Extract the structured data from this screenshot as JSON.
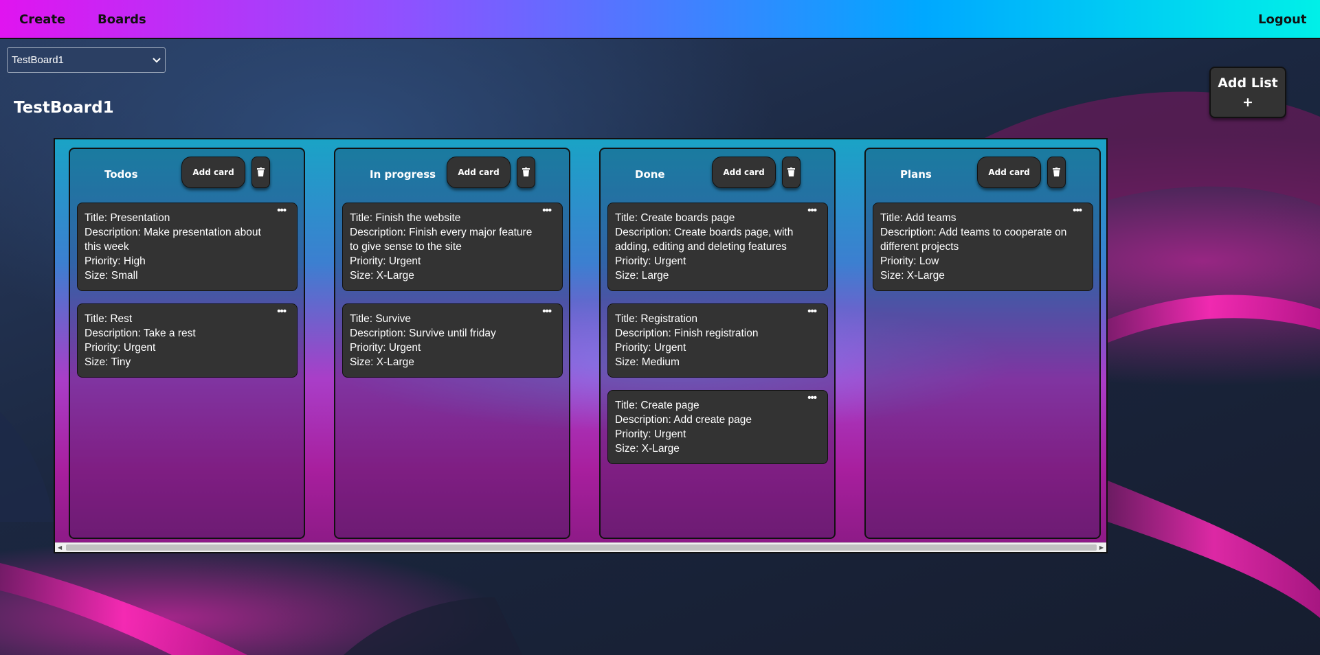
{
  "nav": {
    "create": "Create",
    "boards": "Boards",
    "logout": "Logout"
  },
  "board_select": {
    "selected": "TestBoard1"
  },
  "board": {
    "title": "TestBoard1"
  },
  "add_list": {
    "label": "Add List",
    "plus": "+"
  },
  "lists": [
    {
      "title": "Todos",
      "add_card": "Add card",
      "cards": [
        {
          "title": "Title: Presentation",
          "description": "Description: Make presentation about this week",
          "priority": "Priority: High",
          "size": "Size: Small"
        },
        {
          "title": "Title: Rest",
          "description": "Description: Take a rest",
          "priority": "Priority: Urgent",
          "size": "Size: Tiny"
        }
      ]
    },
    {
      "title": "In progress",
      "add_card": "Add card",
      "cards": [
        {
          "title": "Title: Finish the website",
          "description": "Description: Finish every major feature to give sense to the site",
          "priority": "Priority: Urgent",
          "size": "Size: X-Large"
        },
        {
          "title": "Title: Survive",
          "description": "Description: Survive until friday",
          "priority": "Priority: Urgent",
          "size": "Size: X-Large"
        }
      ]
    },
    {
      "title": "Done",
      "add_card": "Add card",
      "cards": [
        {
          "title": "Title: Create boards page",
          "description": "Description: Create boards page, with adding, editing and deleting features",
          "priority": "Priority: Urgent",
          "size": "Size: Large"
        },
        {
          "title": "Title: Registration",
          "description": "Description: Finish registration",
          "priority": "Priority: Urgent",
          "size": "Size: Medium"
        },
        {
          "title": "Title: Create page",
          "description": "Description: Add create page",
          "priority": "Priority: Urgent",
          "size": "Size: X-Large"
        }
      ]
    },
    {
      "title": "Plans",
      "add_card": "Add card",
      "cards": [
        {
          "title": "Title: Add teams",
          "description": "Description: Add teams to cooperate on different projects",
          "priority": "Priority: Low",
          "size": "Size: X-Large"
        }
      ]
    }
  ],
  "colors": {
    "nav_gradient": [
      "#e014f0",
      "#9150ff",
      "#00a8ff",
      "#00f0e8"
    ],
    "card_bg": "#333333",
    "accent_pink": "#ff28be"
  }
}
